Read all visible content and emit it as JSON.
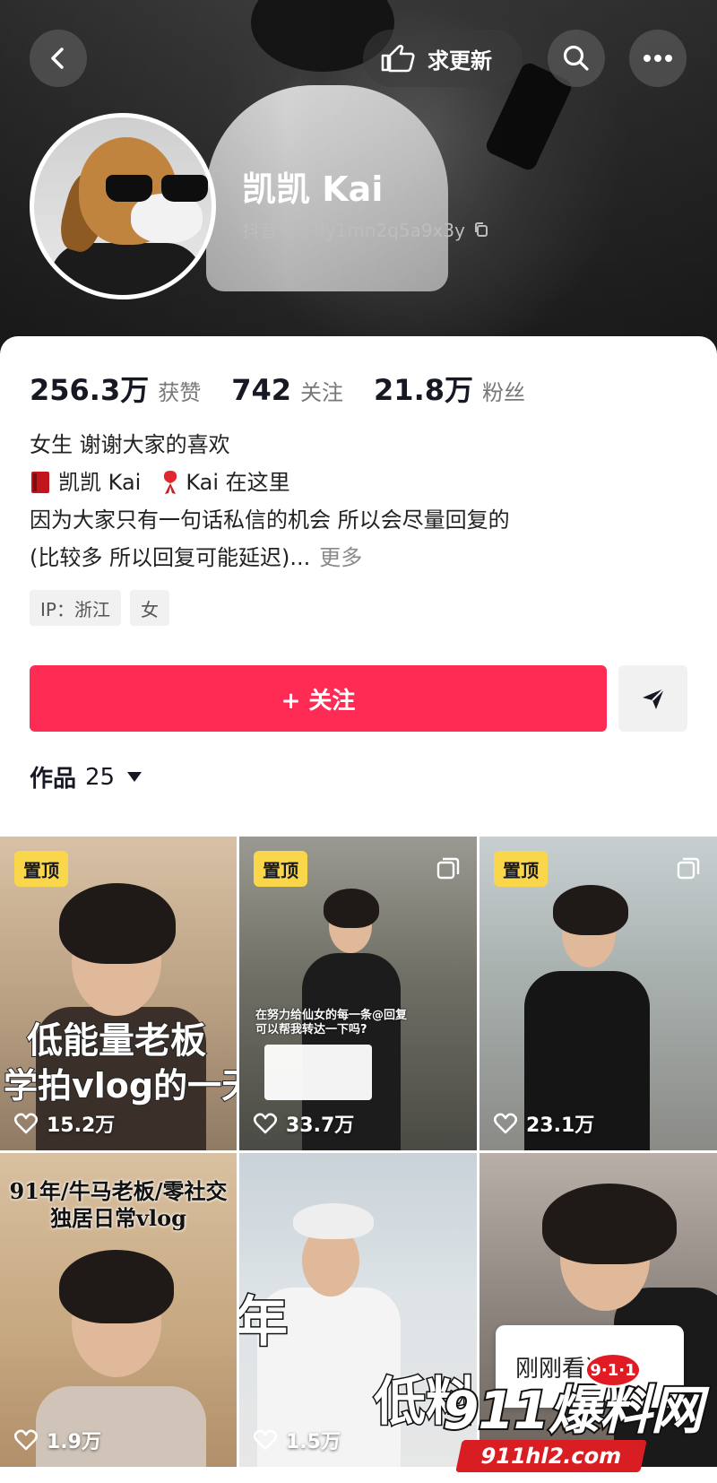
{
  "header": {
    "update_label": "求更新",
    "name": "凯凯 Kai",
    "handle": "抖音号：dy1mn2q5a9x3y",
    "icons": {
      "back": "back-arrow-icon",
      "update": "hand-point-icon",
      "search": "search-icon",
      "more": "more-dots-icon",
      "copy": "copy-icon"
    }
  },
  "stats": [
    {
      "value": "256.3万",
      "label": "获赞"
    },
    {
      "value": "742",
      "label": "关注"
    },
    {
      "value": "21.8万",
      "label": "粉丝"
    }
  ],
  "bio": {
    "line1": "女生 谢谢大家的喜欢",
    "line2a": "凯凯 Kai",
    "line2b": "Kai 在这里",
    "line3": "因为大家只有一句话私信的机会 所以会尽量回复的",
    "line4": "(比较多 所以回复可能延迟)...",
    "more": "更多"
  },
  "tags": [
    "IP：浙江",
    "女"
  ],
  "actions": {
    "follow": "+ 关注",
    "share_icon": "send-icon"
  },
  "works": {
    "label": "作品",
    "count": "25"
  },
  "videos": [
    {
      "pinned": "置顶",
      "likes": "15.2万",
      "overlay1": "低能量老板",
      "overlay2": "学拍vlog的一天"
    },
    {
      "pinned": "置顶",
      "likes": "33.7万",
      "overlay1": "在努力给仙女的每一条@回复",
      "overlay2": "可以帮我转达一下吗?"
    },
    {
      "pinned": "置顶",
      "likes": "23.1万"
    },
    {
      "likes": "1.9万",
      "overlay1": "91年/牛马老板/零社交",
      "overlay2": "独居日常vlog"
    },
    {
      "likes": "1.5万",
      "overlay1": "低料",
      "overlay2": "年"
    },
    {
      "likes": "",
      "popup": "刚刚看过"
    }
  ],
  "watermark": {
    "main": "911爆料网",
    "badge": "9·1·1",
    "url": "911hl2.com"
  },
  "colors": {
    "accent": "#fe2c55",
    "pin": "#f9d64a"
  }
}
